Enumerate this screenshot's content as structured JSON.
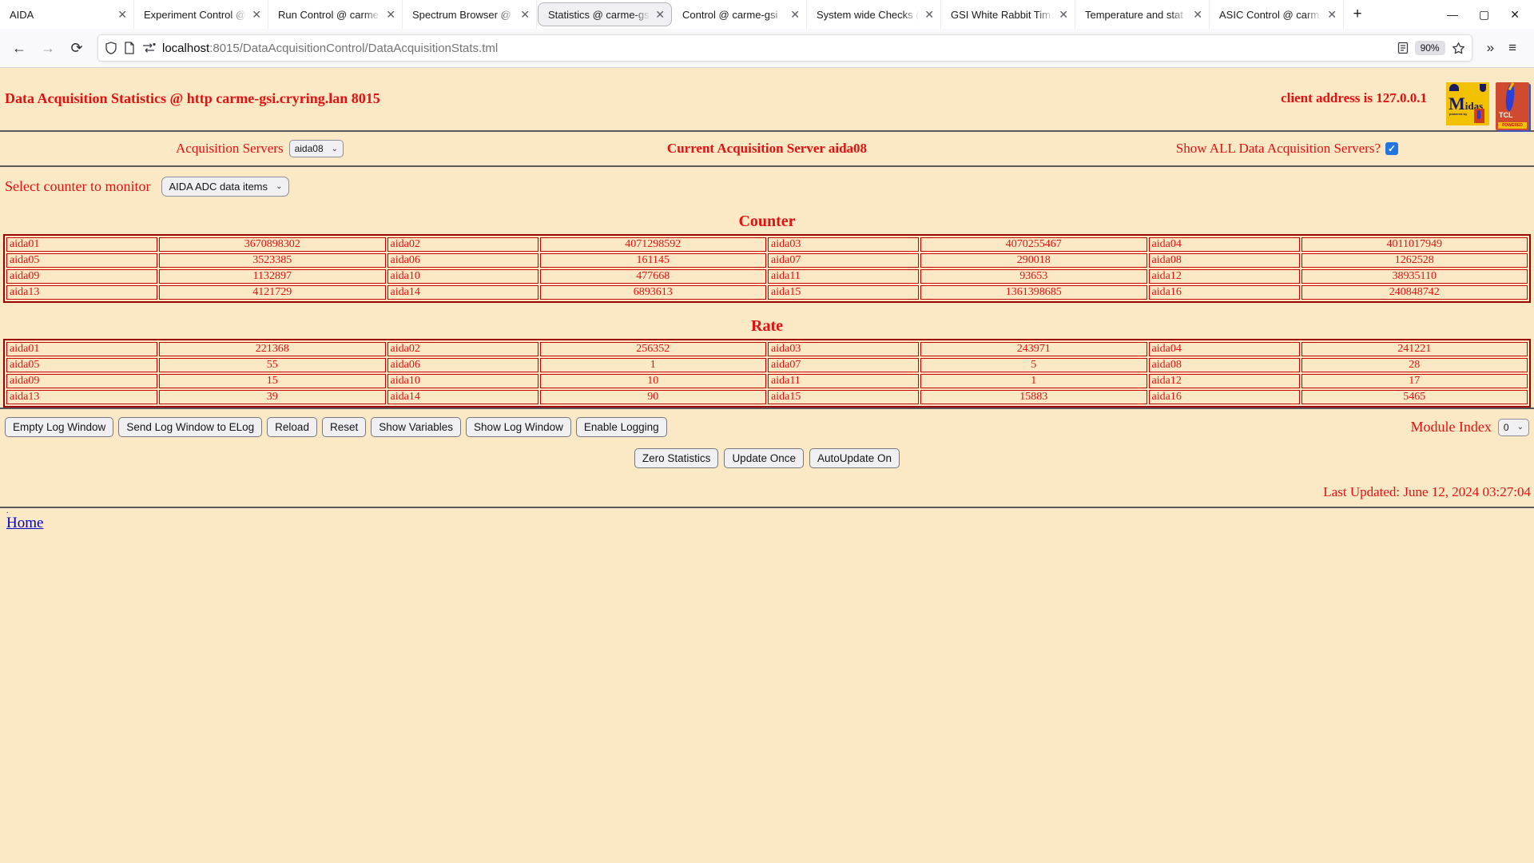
{
  "browser": {
    "tabs": [
      {
        "label": "AIDA",
        "active": false
      },
      {
        "label": "Experiment Control @",
        "active": false
      },
      {
        "label": "Run Control @ carme",
        "active": false
      },
      {
        "label": "Spectrum Browser @",
        "active": false
      },
      {
        "label": "Statistics @ carme-gs",
        "active": true
      },
      {
        "label": "Control @ carme-gsi",
        "active": false
      },
      {
        "label": "System wide Checks (",
        "active": false
      },
      {
        "label": "GSI White Rabbit Tim",
        "active": false
      },
      {
        "label": "Temperature and stat",
        "active": false
      },
      {
        "label": "ASIC Control @ carm",
        "active": false
      }
    ],
    "new_tab": "+",
    "window_controls": {
      "minimize": "—",
      "maximize": "▢",
      "close": "✕"
    },
    "back": "←",
    "forward": "→",
    "reload": "⟳",
    "url_host": "localhost",
    "url_path": ":8015/DataAcquisitionControl/DataAcquisitionStats.tml",
    "zoom": "90%",
    "overflow": "»",
    "menu": "≡"
  },
  "header": {
    "title": "Data Acquisition Statistics @ http carme-gsi.cryring.lan 8015",
    "client": "client address is 127.0.0.1",
    "midas_logo_text": "Midas",
    "midas_powered_by": "powered by",
    "tcl_logo_text": "TCL",
    "tcl_powered_text": "POWERED"
  },
  "controls": {
    "acq_servers_label": "Acquisition Servers",
    "acq_server_value": "aida08",
    "current_server": "Current Acquisition Server aida08",
    "show_all_label": "Show ALL Data Acquisition Servers?",
    "select_counter_label": "Select counter to monitor",
    "counter_select_value": "AIDA ADC data items"
  },
  "tables": {
    "counter": {
      "heading": "Counter",
      "rows": [
        [
          {
            "name": "aida01",
            "value": "3670898302"
          },
          {
            "name": "aida02",
            "value": "4071298592"
          },
          {
            "name": "aida03",
            "value": "4070255467"
          },
          {
            "name": "aida04",
            "value": "4011017949"
          }
        ],
        [
          {
            "name": "aida05",
            "value": "3523385"
          },
          {
            "name": "aida06",
            "value": "161145"
          },
          {
            "name": "aida07",
            "value": "290018"
          },
          {
            "name": "aida08",
            "value": "1262528"
          }
        ],
        [
          {
            "name": "aida09",
            "value": "1132897"
          },
          {
            "name": "aida10",
            "value": "477668"
          },
          {
            "name": "aida11",
            "value": "93653"
          },
          {
            "name": "aida12",
            "value": "38935110"
          }
        ],
        [
          {
            "name": "aida13",
            "value": "4121729"
          },
          {
            "name": "aida14",
            "value": "6893613"
          },
          {
            "name": "aida15",
            "value": "1361398685"
          },
          {
            "name": "aida16",
            "value": "240848742"
          }
        ]
      ]
    },
    "rate": {
      "heading": "Rate",
      "rows": [
        [
          {
            "name": "aida01",
            "value": "221368"
          },
          {
            "name": "aida02",
            "value": "256352"
          },
          {
            "name": "aida03",
            "value": "243971"
          },
          {
            "name": "aida04",
            "value": "241221"
          }
        ],
        [
          {
            "name": "aida05",
            "value": "55"
          },
          {
            "name": "aida06",
            "value": "1"
          },
          {
            "name": "aida07",
            "value": "5"
          },
          {
            "name": "aida08",
            "value": "28"
          }
        ],
        [
          {
            "name": "aida09",
            "value": "15"
          },
          {
            "name": "aida10",
            "value": "10"
          },
          {
            "name": "aida11",
            "value": "1"
          },
          {
            "name": "aida12",
            "value": "17"
          }
        ],
        [
          {
            "name": "aida13",
            "value": "39"
          },
          {
            "name": "aida14",
            "value": "90"
          },
          {
            "name": "aida15",
            "value": "15883"
          },
          {
            "name": "aida16",
            "value": "5465"
          }
        ]
      ]
    }
  },
  "toolbar": {
    "buttons": [
      "Empty Log Window",
      "Send Log Window to ELog",
      "Reload",
      "Reset",
      "Show Variables",
      "Show Log Window",
      "Enable Logging"
    ],
    "module_index_label": "Module Index",
    "module_index_value": "0",
    "center_buttons": [
      "Zero Statistics",
      "Update Once",
      "AutoUpdate On"
    ]
  },
  "footer": {
    "last_updated": "Last Updated: June 12, 2024 03:27:04",
    "dot": ".",
    "home": "Home"
  },
  "colors": {
    "page_bg": "#fbe8c5",
    "text_red": "#e31111",
    "table_border": "#cc0000",
    "link_blue": "#0000cc",
    "checkbox_blue": "#2374e1"
  }
}
